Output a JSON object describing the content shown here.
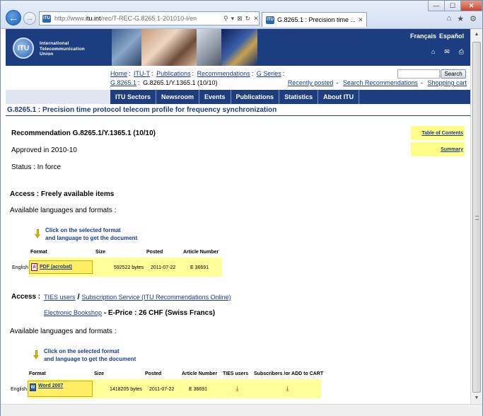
{
  "browser": {
    "url_prefix": "http://www.",
    "url_domain": "itu.int",
    "url_rest": "/rec/T-REC-G.8265.1-201010-I/en",
    "favicon_text": "ITU",
    "tab_title": "G.8265.1 : Precision time ...",
    "back_glyph": "←",
    "forward_glyph": "→",
    "addr_icons": [
      "⚲",
      "▾",
      "⊠",
      "↻",
      "✕"
    ],
    "tab_close": "✕",
    "window_controls": {
      "minimize": "—",
      "maximize": "☐",
      "close": "✕"
    },
    "right_icons": [
      "⌂",
      "★",
      "⚙"
    ]
  },
  "banner": {
    "logo_text": "ITU",
    "org_lines": [
      "International",
      "Telecommunication",
      "Union"
    ],
    "lang_links": [
      "Français",
      "Español"
    ],
    "icons": [
      "sitemap-icon",
      "mail-icon",
      "print-icon"
    ],
    "icon_glyphs": [
      "⌂",
      "✉",
      "⎙"
    ]
  },
  "breadcrumb": {
    "items": [
      "Home",
      "ITU-T",
      "Publications",
      "Recommendations",
      "G Series",
      "G.8265.1"
    ],
    "current": "G.8265.1/Y.1365.1 (10/10)",
    "separator": ":"
  },
  "search": {
    "button_label": "Search"
  },
  "util_links": {
    "recently_posted": "Recently posted",
    "search_recs": "Search Recommendations",
    "shopping_cart": "Shopping cart",
    "separator": "-"
  },
  "topnav": [
    "ITU Sectors",
    "Newsroom",
    "Events",
    "Publications",
    "Statistics",
    "About ITU"
  ],
  "page_title": "G.8265.1 : Precision time protocol telecom profile for frequency synchronization",
  "recommendation": {
    "title": "Recommendation G.8265.1/Y.1365.1 (10/10)",
    "approved": "Approved in 2010-10",
    "status": "Status : In force"
  },
  "side_links": {
    "toc": "Table of Contents",
    "summary": "Summary"
  },
  "free_section": {
    "access_title": "Access : Freely available items",
    "available_text": "Available languages and formats :",
    "click_note": [
      "Click on the selected format",
      "and language to get the document"
    ],
    "headers": [
      "Format",
      "Size",
      "Posted",
      "Article Number"
    ],
    "rows": [
      {
        "language": "English",
        "format": "PDF (acrobat)",
        "size": "592522 bytes",
        "posted": "2011-07-22",
        "article": "E 36691"
      }
    ]
  },
  "paid_section": {
    "access_label": "Access :",
    "ties_users": "TIES users",
    "slash": "/",
    "subscription": "Subscription Service (ITU Recommendations Online)",
    "bookshop": "Electronic Bookshop",
    "eprice": " - E-Price : 26 CHF (Swiss Francs)",
    "available_text": "Available languages and formats :",
    "click_note": [
      "Click on the selected format",
      "and language to get the document"
    ],
    "headers": [
      "Format",
      "Size",
      "Posted",
      "Article Number",
      "TIES users",
      "Subscribers /or ADD to CART"
    ],
    "rows": [
      {
        "language": "English",
        "format": "Word 2007",
        "size": "1418205 bytes",
        "posted": "2011-07-22",
        "article": "E 36691"
      }
    ]
  },
  "scrollbar": {
    "up": "▲",
    "down": "▼"
  },
  "colors": {
    "brand_navy": "#1c3d7f",
    "highlight_yellow": "#ffff99",
    "link_blue": "#1a3b8f"
  }
}
